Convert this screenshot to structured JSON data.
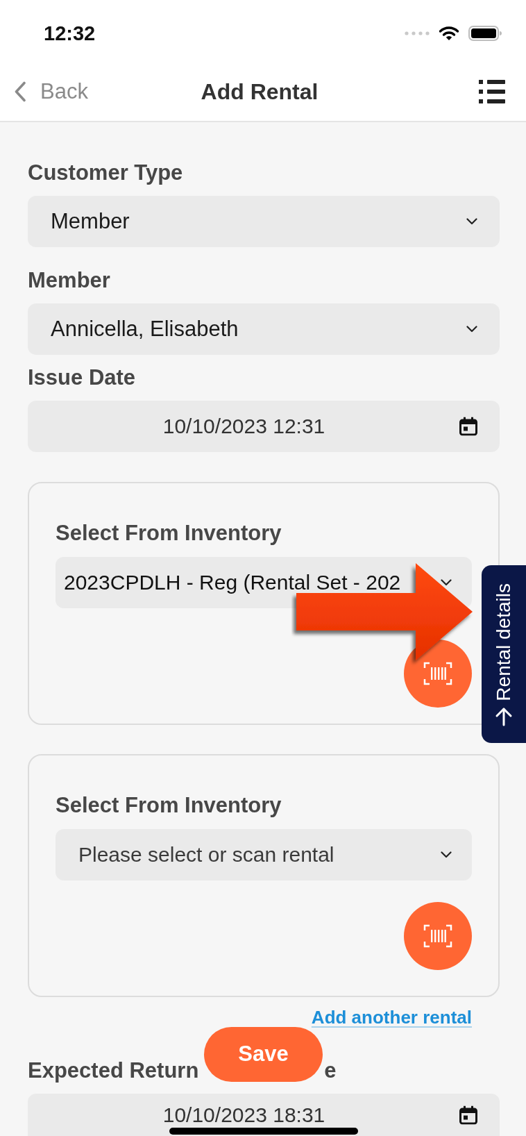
{
  "status_bar": {
    "time": "12:32"
  },
  "nav_bar": {
    "back": "Back",
    "title": "Add Rental"
  },
  "fields": [
    {
      "kind": "select",
      "label": "Customer Type",
      "value": "Member"
    },
    {
      "kind": "select",
      "label": "Member",
      "value": "Annicella, Elisabeth"
    },
    {
      "kind": "date",
      "label": "Issue Date",
      "value": "10/10/2023 12:31"
    }
  ],
  "rentals": [
    {
      "label": "Select From Inventory",
      "value": "2023CPDLH - Reg (Rental Set - 202"
    },
    {
      "label": "Select From Inventory",
      "placeholder": "Please select or scan rental"
    }
  ],
  "add_rental_link": "Add another rental",
  "save_button": "Save",
  "return_date": {
    "label_parts": [
      "Expected Return",
      "e"
    ],
    "value": "10/10/2023 18:31"
  },
  "side_tab": {
    "label": "Rental details"
  }
}
